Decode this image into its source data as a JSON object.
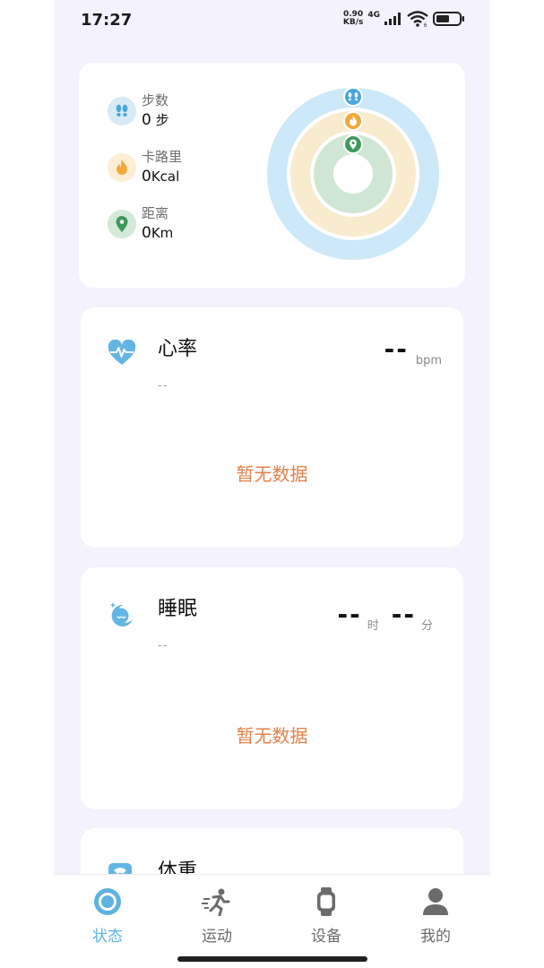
{
  "status_bar": {
    "time": "17:27",
    "net_speed_value": "0.90",
    "net_speed_unit": "KB/s",
    "network": "4G",
    "wifi_sub": "6"
  },
  "activity": {
    "steps": {
      "label": "步数",
      "value": "0",
      "unit": " 步"
    },
    "calories": {
      "label": "卡路里",
      "value": "0",
      "unit": "Kcal"
    },
    "distance": {
      "label": "距离",
      "value": "0",
      "unit": "Km"
    },
    "ring_colors": {
      "steps": "#cde8f8",
      "calories": "#f9ebce",
      "distance": "#cfe6d4"
    }
  },
  "heart_rate": {
    "title": "心率",
    "subtitle": "--",
    "value": "--",
    "unit": "bpm",
    "empty_text": "暂无数据"
  },
  "sleep": {
    "title": "睡眠",
    "subtitle": "--",
    "hours_value": "--",
    "hours_unit": "时",
    "minutes_value": "--",
    "minutes_unit": "分",
    "empty_text": "暂无数据"
  },
  "weight": {
    "title": "体重"
  },
  "nav": {
    "items": [
      {
        "label": "状态",
        "active": true
      },
      {
        "label": "运动",
        "active": false
      },
      {
        "label": "设备",
        "active": false
      },
      {
        "label": "我的",
        "active": false
      }
    ]
  },
  "colors": {
    "accent": "#5db3e2",
    "empty_text": "#e0824a",
    "background": "#f3f2fd"
  }
}
